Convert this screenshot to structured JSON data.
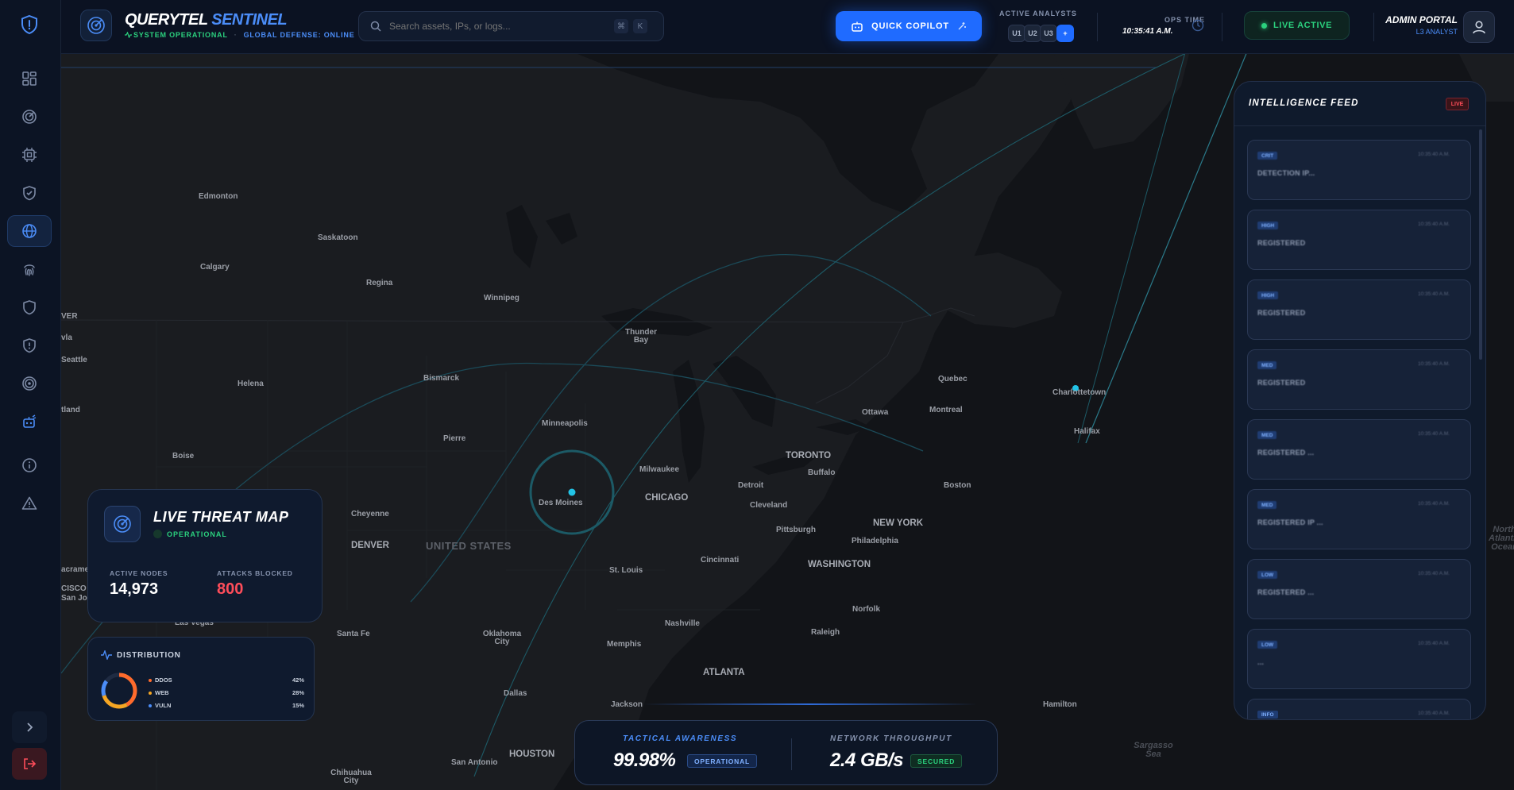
{
  "header": {
    "brand_primary": "QUERYTEL",
    "brand_secondary": "SENTINEL",
    "status_system": "SYSTEM OPERATIONAL",
    "status_separator": "·",
    "status_defense": "GLOBAL DEFENSE: ONLINE",
    "search_placeholder": "Search assets, IPs, or logs...",
    "search_kbd_1": "⌘",
    "search_kbd_2": "K",
    "copilot_label": "QUICK COPILOT",
    "analysts_label": "ACTIVE ANALYSTS",
    "analysts": [
      "U1",
      "U2",
      "U3"
    ],
    "analysts_add": "+",
    "ops_label": "OPS TIME",
    "ops_time": "10:35:41 A.M.",
    "live_label": "LIVE ACTIVE",
    "admin_title": "ADMIN PORTAL",
    "admin_sub": "L3 ANALYST"
  },
  "sidebar": {
    "items": [
      {
        "name": "dashboard",
        "icon": "grid-icon"
      },
      {
        "name": "radar",
        "icon": "radar-icon"
      },
      {
        "name": "cpu",
        "icon": "chip-icon"
      },
      {
        "name": "shield-check",
        "icon": "shield-check-icon"
      },
      {
        "name": "globe",
        "icon": "globe-icon",
        "active": true
      },
      {
        "name": "fingerprint",
        "icon": "fingerprint-icon"
      },
      {
        "name": "shield",
        "icon": "shield-icon"
      },
      {
        "name": "shield-alert",
        "icon": "shield-alert-icon"
      },
      {
        "name": "target",
        "icon": "target-icon"
      },
      {
        "name": "bot",
        "icon": "bot-icon"
      },
      {
        "name": "info",
        "icon": "info-icon"
      },
      {
        "name": "alert",
        "icon": "alert-triangle-icon"
      }
    ]
  },
  "map": {
    "cities": [
      {
        "label": "Edmonton",
        "big": false
      },
      {
        "label": "Saskatoon",
        "big": false
      },
      {
        "label": "Calgary",
        "big": false
      },
      {
        "label": "Regina",
        "big": false
      },
      {
        "label": "Winnipeg",
        "big": false
      },
      {
        "label": "Thunder Bay",
        "big": false
      },
      {
        "label": "Bismarck",
        "big": false
      },
      {
        "label": "Helena",
        "big": false
      },
      {
        "label": "Seattle",
        "big": false
      },
      {
        "label": "Pierre",
        "big": false
      },
      {
        "label": "Minneapolis",
        "big": false
      },
      {
        "label": "Boise",
        "big": false
      },
      {
        "label": "Des Moines",
        "big": false
      },
      {
        "label": "Milwaukee",
        "big": false
      },
      {
        "label": "CHICAGO",
        "big": true
      },
      {
        "label": "Detroit",
        "big": false
      },
      {
        "label": "TORONTO",
        "big": true
      },
      {
        "label": "Buffalo",
        "big": false
      },
      {
        "label": "Ottawa",
        "big": false
      },
      {
        "label": "Montreal",
        "big": false
      },
      {
        "label": "Quebec",
        "big": false
      },
      {
        "label": "Charlottetown",
        "big": false
      },
      {
        "label": "Halifax",
        "big": false
      },
      {
        "label": "Boston",
        "big": false
      },
      {
        "label": "Cleveland",
        "big": false
      },
      {
        "label": "Pittsburgh",
        "big": false
      },
      {
        "label": "NEW YORK",
        "big": true
      },
      {
        "label": "Philadelphia",
        "big": false
      },
      {
        "label": "WASHINGTON",
        "big": true
      },
      {
        "label": "Cheyenne",
        "big": false
      },
      {
        "label": "DENVER",
        "big": true
      },
      {
        "label": "Cincinnati",
        "big": false
      },
      {
        "label": "St. Louis",
        "big": false
      },
      {
        "label": "Norfolk",
        "big": false
      },
      {
        "label": "Nashville",
        "big": false
      },
      {
        "label": "Raleigh",
        "big": false
      },
      {
        "label": "Santa Fe",
        "big": false
      },
      {
        "label": "Oklahoma City",
        "big": false
      },
      {
        "label": "Memphis",
        "big": false
      },
      {
        "label": "ATLANTA",
        "big": true
      },
      {
        "label": "Las Vegas",
        "big": false
      },
      {
        "label": "Dallas",
        "big": false
      },
      {
        "label": "Jackson",
        "big": false
      },
      {
        "label": "Hamilton",
        "big": false
      },
      {
        "label": "HOUSTON",
        "big": true
      },
      {
        "label": "San Antonio",
        "big": false
      },
      {
        "label": "Chihuahua City",
        "big": false
      }
    ],
    "country_label": "UNITED STATES",
    "water_labels": [
      "Sargasso Sea",
      "North Atlantic Ocean"
    ],
    "edge_labels": [
      "VER",
      "vla",
      "tland",
      "acrame",
      "CISCO",
      "San Jo"
    ]
  },
  "threat_card": {
    "title": "LIVE THREAT MAP",
    "status": "OPERATIONAL",
    "active_nodes_label": "ACTIVE NODES",
    "active_nodes_value": "14,973",
    "attacks_blocked_label": "ATTACKS BLOCKED",
    "attacks_blocked_value": "800"
  },
  "distribution": {
    "title": "DISTRIBUTION",
    "rows": [
      {
        "label": "DDOS",
        "value": "42%",
        "color": "#ff6b2c"
      },
      {
        "label": "WEB",
        "value": "28%",
        "color": "#f5a623"
      },
      {
        "label": "VULN",
        "value": "15%",
        "color": "#4b8df8"
      }
    ]
  },
  "metrics": {
    "tactical_label": "TACTICAL AWARENESS",
    "tactical_value": "99.98%",
    "tactical_badge": "OPERATIONAL",
    "throughput_label": "NETWORK THROUGHPUT",
    "throughput_value": "2.4 GB/s",
    "throughput_badge": "SECURED"
  },
  "feed": {
    "title": "INTELLIGENCE FEED",
    "live_badge": "LIVE",
    "items": [
      {
        "tag": "CRIT",
        "time": "10:35:40 A.M.",
        "text": "DETECTION IP..."
      },
      {
        "tag": "HIGH",
        "time": "10:35:40 A.M.",
        "text": "REGISTERED"
      },
      {
        "tag": "HIGH",
        "time": "10:35:40 A.M.",
        "text": "REGISTERED"
      },
      {
        "tag": "MED",
        "time": "10:35:40 A.M.",
        "text": "REGISTERED"
      },
      {
        "tag": "MED",
        "time": "10:35:40 A.M.",
        "text": "REGISTERED ..."
      },
      {
        "tag": "MED",
        "time": "10:35:40 A.M.",
        "text": "REGISTERED IP ..."
      },
      {
        "tag": "LOW",
        "time": "10:35:40 A.M.",
        "text": "REGISTERED ..."
      },
      {
        "tag": "LOW",
        "time": "10:35:40 A.M.",
        "text": "..."
      },
      {
        "tag": "INFO",
        "time": "10:35:40 A.M.",
        "text": ""
      }
    ]
  },
  "colors": {
    "accent": "#1f6bff",
    "success": "#2bd17e",
    "danger": "#ff4d5a",
    "panel": "#0f1a2e"
  }
}
